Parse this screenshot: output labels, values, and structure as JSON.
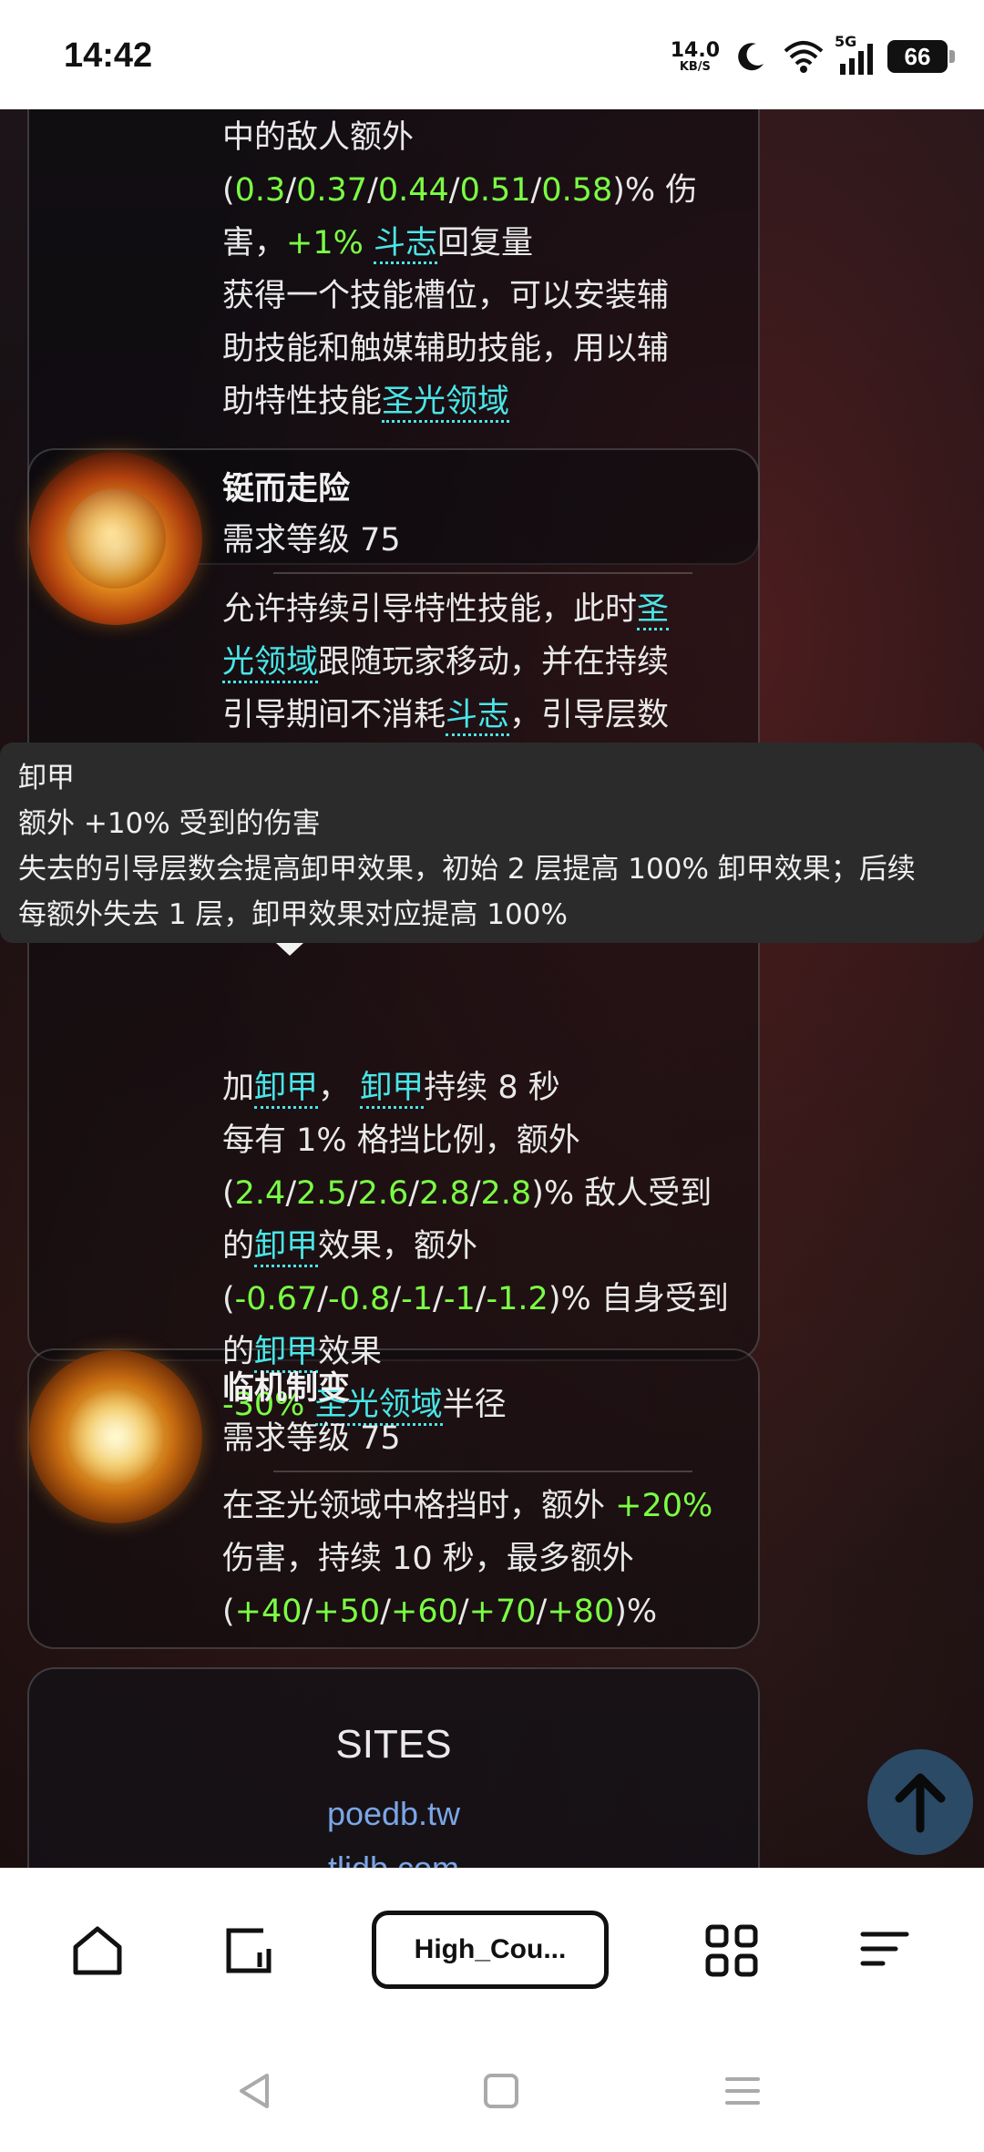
{
  "status_bar": {
    "time": "14:42",
    "net_speed_value": "14.0",
    "net_speed_unit": "KB/S",
    "network": "5G",
    "battery": "66"
  },
  "skill_top": {
    "line1": "中的敌人额外",
    "line2_values": [
      "0.3",
      "0.37",
      "0.44",
      "0.51",
      "0.58"
    ],
    "line2_suffix": ")% 伤",
    "line3_pre": "害，",
    "line3_value": "+1%",
    "line3_link": "斗志",
    "line3_post": "回复量",
    "line4": "获得一个技能槽位，可以安装辅",
    "line5": "助技能和触媒辅助技能，用以辅",
    "line6_pre": "助特性技能",
    "line6_link": "圣光领域"
  },
  "skill_1": {
    "name": "铤而走险",
    "requirement": "需求等级 75",
    "line1_pre": "允许持续引导特性技能，此时",
    "line1_link": "圣",
    "line2_link": "光领域",
    "line2_post": "跟随玩家移动，并在持续",
    "line3_pre": "引导期间不消耗",
    "line3_link": "斗志",
    "line3_post": "，引导层数",
    "line4_pre": "加",
    "line4_link1": "卸甲",
    "line4_mid": "，",
    "line4_link2": "卸甲",
    "line4_post": "持续 8 秒",
    "line5": "每有 1% 格挡比例，额外",
    "line6_values": [
      "2.4",
      "2.5",
      "2.6",
      "2.8",
      "2.8"
    ],
    "line6_suffix": ")% 敌人受到",
    "line7_pre": "的",
    "line7_link": "卸甲",
    "line7_post": "效果，额外",
    "line8_values": [
      "-0.67",
      "-0.8",
      "-1",
      "-1",
      "-1.2"
    ],
    "line8_suffix": ")% 自身受到",
    "line9_pre": "的",
    "line9_link": "卸甲",
    "line9_post": "效果",
    "line10_value": "-30%",
    "line10_link": "圣光领域",
    "line10_post": "半径"
  },
  "tooltip": {
    "title": "卸甲",
    "line1": "额外 +10% 受到的伤害",
    "line2": "失去的引导层数会提高卸甲效果，初始 2 层提高 100% 卸甲效果；后续",
    "line3": "每额外失去 1 层，卸甲效果对应提高 100%"
  },
  "skill_2": {
    "name": "临机制变",
    "requirement": "需求等级 75",
    "line1_pre": "在圣光领域中格挡时，额外",
    "line1_value": "+20%",
    "line2": "伤害，持续 10 秒，最多额外",
    "line3_values": [
      "+40",
      "+50",
      "+60",
      "+70",
      "+80"
    ],
    "line3_suffix": ")%"
  },
  "sites": {
    "title": "SITES",
    "links": [
      "poedb.tw",
      "tlidb.com"
    ]
  },
  "toolbar": {
    "tab_label": "High_Cou..."
  },
  "colors": {
    "value_green": "#7bff44",
    "link_cyan": "#49e6e8",
    "site_link": "#7aa6e6",
    "scroll_top_bg": "#2b4a66"
  }
}
